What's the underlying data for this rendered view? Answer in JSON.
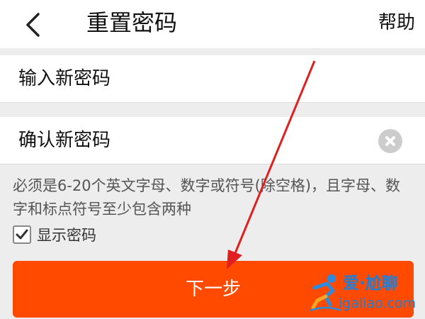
{
  "header": {
    "title": "重置密码",
    "help_label": "帮助",
    "back_icon": "chevron-left-icon"
  },
  "fields": {
    "new_password": {
      "placeholder": "输入新密码",
      "value": ""
    },
    "confirm_password": {
      "placeholder": "确认新密码",
      "value": "",
      "clear_icon": "clear-icon"
    }
  },
  "hint": "必须是6-20个英文字母、数字或符号(除空格)，且字母、数字和标点符号至少包含两种",
  "show_password": {
    "label": "显示密码",
    "checked": true
  },
  "next_button": {
    "label": "下一步"
  },
  "colors": {
    "primary_button": "#ff4a00",
    "background": "#ededed",
    "annotation_arrow": "#e02020",
    "watermark": "#1e7fd6"
  },
  "watermark": {
    "brand": "爱·尬聊",
    "domain": "igaliao.com"
  }
}
